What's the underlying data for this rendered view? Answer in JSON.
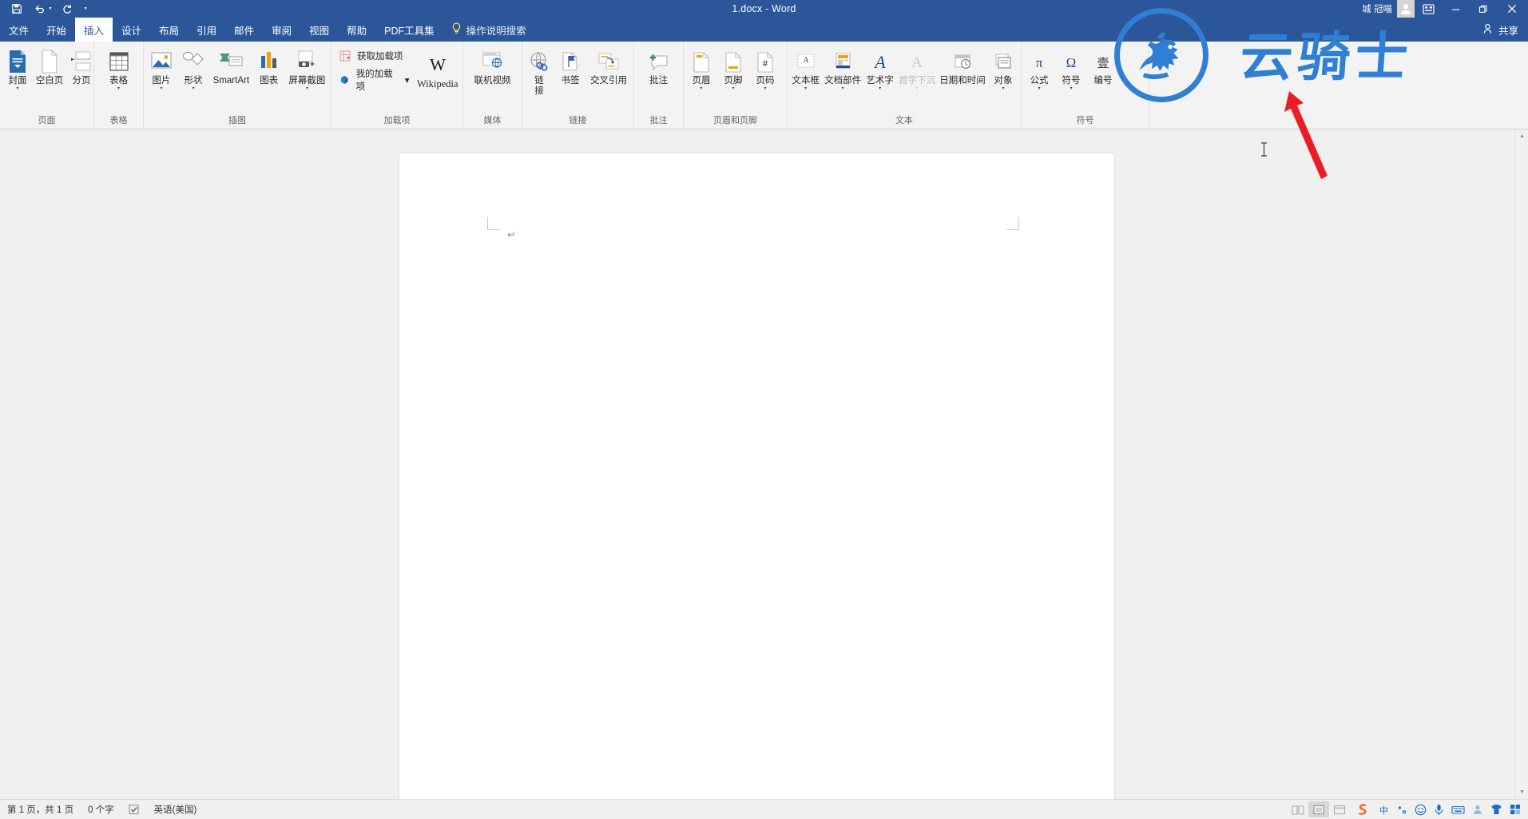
{
  "titlebar": {
    "quick_access": [
      {
        "name": "save-icon",
        "label": "保存"
      },
      {
        "name": "undo-icon",
        "label": "撤消"
      },
      {
        "name": "redo-icon",
        "label": "恢复"
      },
      {
        "name": "customize-qat-icon",
        "label": "自定义快速访问工具栏"
      }
    ],
    "document_title": "1.docx  -  Word",
    "account_name": "城 冠喵",
    "ribbon_display_options": "功能区显示选项",
    "minimize": "最小化",
    "restore": "向下还原",
    "close": "关闭"
  },
  "tabs": [
    {
      "label": "文件",
      "active": false
    },
    {
      "label": "开始",
      "active": false
    },
    {
      "label": "插入",
      "active": true
    },
    {
      "label": "设计",
      "active": false
    },
    {
      "label": "布局",
      "active": false
    },
    {
      "label": "引用",
      "active": false
    },
    {
      "label": "邮件",
      "active": false
    },
    {
      "label": "审阅",
      "active": false
    },
    {
      "label": "视图",
      "active": false
    },
    {
      "label": "帮助",
      "active": false
    },
    {
      "label": "PDF工具集",
      "active": false
    }
  ],
  "tell_me": "操作说明搜索",
  "share_label": "共享",
  "ribbon": {
    "groups": [
      {
        "label": "页面",
        "items": [
          {
            "label": "封面",
            "icon": "cover-page-icon",
            "dropdown": true
          },
          {
            "label": "空白页",
            "icon": "blank-page-icon",
            "dropdown": false
          },
          {
            "label": "分页",
            "icon": "page-break-icon",
            "dropdown": false
          }
        ]
      },
      {
        "label": "表格",
        "items": [
          {
            "label": "表格",
            "icon": "table-icon",
            "dropdown": true
          }
        ]
      },
      {
        "label": "插图",
        "items": [
          {
            "label": "图片",
            "icon": "picture-icon",
            "dropdown": true
          },
          {
            "label": "形状",
            "icon": "shapes-icon",
            "dropdown": true
          },
          {
            "label": "SmartArt",
            "icon": "smartart-icon",
            "dropdown": false
          },
          {
            "label": "图表",
            "icon": "chart-icon",
            "dropdown": false
          },
          {
            "label": "屏幕截图",
            "icon": "screenshot-icon",
            "dropdown": true
          }
        ]
      },
      {
        "label": "加载项",
        "small_items": [
          {
            "label": "获取加载项",
            "icon": "get-addins-icon"
          },
          {
            "label": "我的加载项",
            "icon": "my-addins-icon",
            "dropdown": true
          }
        ],
        "items": [
          {
            "label": "Wikipedia",
            "icon": "wikipedia-icon",
            "dropdown": false
          }
        ]
      },
      {
        "label": "媒体",
        "items": [
          {
            "label": "联机视频",
            "icon": "online-video-icon",
            "dropdown": false
          }
        ]
      },
      {
        "label": "链接",
        "items": [
          {
            "label": "链 接",
            "icon": "link-icon",
            "dropdown": false
          },
          {
            "label": "书签",
            "icon": "bookmark-icon",
            "dropdown": false
          },
          {
            "label": "交叉引用",
            "icon": "cross-reference-icon",
            "dropdown": false
          }
        ]
      },
      {
        "label": "批注",
        "items": [
          {
            "label": "批注",
            "icon": "new-comment-icon",
            "dropdown": false
          }
        ]
      },
      {
        "label": "页眉和页脚",
        "items": [
          {
            "label": "页眉",
            "icon": "header-icon",
            "dropdown": true
          },
          {
            "label": "页脚",
            "icon": "footer-icon",
            "dropdown": true
          },
          {
            "label": "页码",
            "icon": "page-number-icon",
            "dropdown": true
          }
        ]
      },
      {
        "label": "文本",
        "items": [
          {
            "label": "文本框",
            "icon": "text-box-icon",
            "dropdown": true
          },
          {
            "label": "文档部件",
            "icon": "quick-parts-icon",
            "dropdown": true
          },
          {
            "label": "艺术字",
            "icon": "wordart-icon",
            "dropdown": true
          },
          {
            "label": "首字下沉",
            "icon": "drop-cap-icon",
            "dropdown": true,
            "disabled": true
          },
          {
            "label": "日期和时间",
            "icon": "date-time-icon",
            "dropdown": false
          },
          {
            "label": "对象",
            "icon": "object-icon",
            "dropdown": true
          }
        ]
      },
      {
        "label": "符号",
        "items": [
          {
            "label": "公式",
            "icon": "equation-icon",
            "dropdown": true
          },
          {
            "label": "符号",
            "icon": "symbol-icon",
            "dropdown": true
          },
          {
            "label": "编号",
            "icon": "number-icon",
            "dropdown": false
          }
        ]
      }
    ]
  },
  "statusbar": {
    "page_info": "第 1 页，共 1 页",
    "word_count": "0 个字",
    "proofing_icon": "proofing-errors-icon",
    "language": "英语(美国)",
    "views": [
      {
        "name": "read-mode-view",
        "selected": false
      },
      {
        "name": "print-layout-view",
        "selected": true
      },
      {
        "name": "web-layout-view",
        "selected": false
      }
    ],
    "ime": {
      "logo": "sogou-ime-icon",
      "tools": [
        "chinese-english-toggle",
        "punctuation-icon",
        "emoji-icon",
        "voice-input-icon",
        "soft-keyboard-icon",
        "user-icon",
        "skin-icon",
        "toolbox-icon"
      ]
    }
  },
  "watermark": {
    "text": "云骑士",
    "color": "#2f7fd4"
  },
  "annotation": {
    "arrow_color": "#ec1c24",
    "points_to": "符号"
  }
}
